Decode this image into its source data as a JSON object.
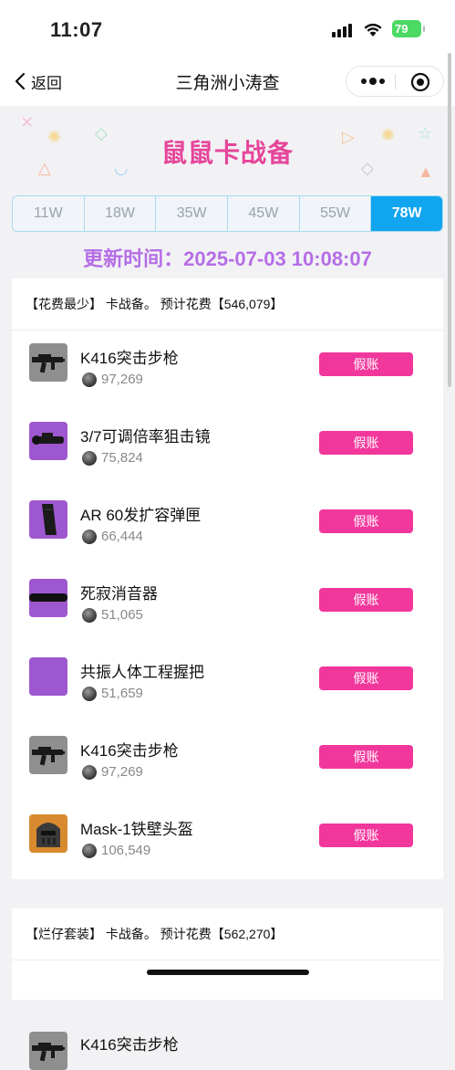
{
  "status": {
    "time": "11:07",
    "battery": "79"
  },
  "nav": {
    "back_label": "返回",
    "title": "三角洲小涛查"
  },
  "banner": {
    "title": "鼠鼠卡战备"
  },
  "tabs": [
    {
      "label": "11W",
      "active": false
    },
    {
      "label": "18W",
      "active": false
    },
    {
      "label": "35W",
      "active": false
    },
    {
      "label": "45W",
      "active": false
    },
    {
      "label": "55W",
      "active": false
    },
    {
      "label": "78W",
      "active": true
    }
  ],
  "update": {
    "text": "更新时间：2025-07-03 10:08:07"
  },
  "card1": {
    "header": "【花费最少】 卡战备。 预计花费【546,079】",
    "items": [
      {
        "name": "K416突击步枪",
        "price": "97,269",
        "button": "假账",
        "icon": "rifle-icon",
        "thumb_color": "gray"
      },
      {
        "name": "3/7可调倍率狙击镜",
        "price": "75,824",
        "button": "假账",
        "icon": "scope-icon",
        "thumb_color": "purple"
      },
      {
        "name": "AR 60发扩容弹匣",
        "price": "66,444",
        "button": "假账",
        "icon": "magazine-icon",
        "thumb_color": "purple"
      },
      {
        "name": "死寂消音器",
        "price": "51,065",
        "button": "假账",
        "icon": "suppressor-icon",
        "thumb_color": "purple"
      },
      {
        "name": "共振人体工程握把",
        "price": "51,659",
        "button": "假账",
        "icon": "grip-icon",
        "thumb_color": "purple"
      },
      {
        "name": "K416突击步枪",
        "price": "97,269",
        "button": "假账",
        "icon": "rifle-icon",
        "thumb_color": "gray"
      },
      {
        "name": "Mask-1铁壁头盔",
        "price": "106,549",
        "button": "假账",
        "icon": "helmet-icon",
        "thumb_color": "orange"
      }
    ]
  },
  "card2": {
    "header": "【烂仔套装】 卡战备。 预计花费【562,270】",
    "items": [
      {
        "name": "K416突击步枪",
        "icon": "rifle-icon",
        "thumb_color": "gray"
      }
    ]
  }
}
